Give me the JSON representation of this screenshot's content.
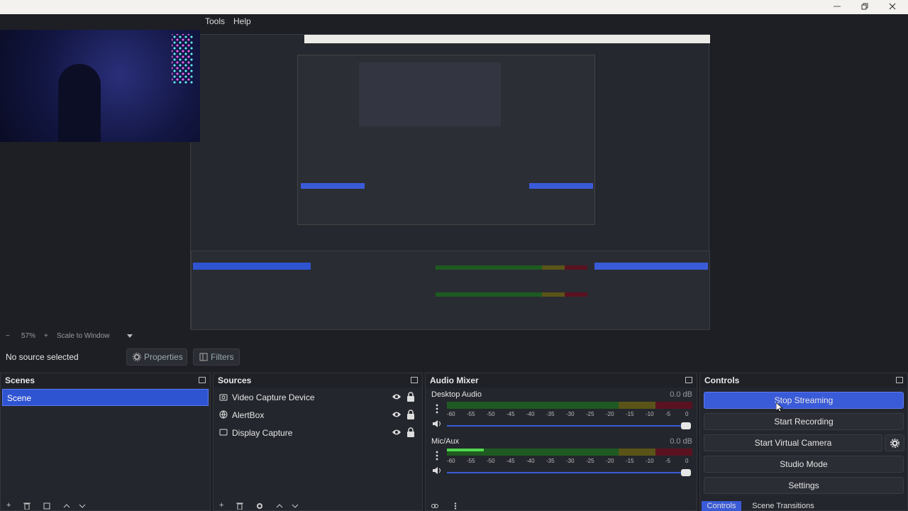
{
  "menu": {
    "tools": "Tools",
    "help": "Help"
  },
  "zoom": {
    "minus": "−",
    "level": "57%",
    "plus": "+",
    "mode": "Scale to Window"
  },
  "source_bar": {
    "no_source": "No source selected",
    "properties": "Properties",
    "filters": "Filters"
  },
  "scenes": {
    "title": "Scenes",
    "items": [
      "Scene"
    ]
  },
  "sources": {
    "title": "Sources",
    "items": [
      {
        "label": "Video Capture Device",
        "icon": "camera-icon"
      },
      {
        "label": "AlertBox",
        "icon": "browser-icon"
      },
      {
        "label": "Display Capture",
        "icon": "monitor-icon"
      }
    ]
  },
  "mixer": {
    "title": "Audio Mixer",
    "ticks": [
      "-60",
      "-55",
      "-50",
      "-45",
      "-40",
      "-35",
      "-30",
      "-25",
      "-20",
      "-15",
      "-10",
      "-5",
      "0"
    ],
    "channels": [
      {
        "name": "Desktop Audio",
        "db": "0.0 dB",
        "level": 0.0
      },
      {
        "name": "Mic/Aux",
        "db": "0.0 dB",
        "level": 0.15
      }
    ]
  },
  "controls": {
    "title": "Controls",
    "stop_streaming": "Stop Streaming",
    "start_recording": "Start Recording",
    "start_virtual_camera": "Start Virtual Camera",
    "studio_mode": "Studio Mode",
    "settings": "Settings"
  },
  "tabs": {
    "controls": "Controls",
    "scene_transitions": "Scene Transitions"
  },
  "colors": {
    "accent": "#3a5bd8",
    "panel": "#24262d",
    "background": "#1e1f24"
  }
}
